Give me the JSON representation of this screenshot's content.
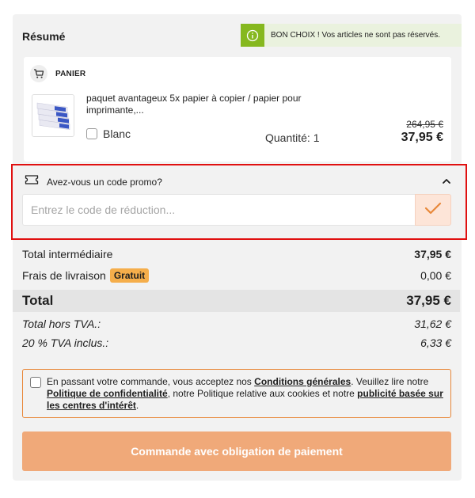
{
  "summary": {
    "title": "Résumé",
    "notice": "BON CHOIX ! Vos articles ne sont pas réservés."
  },
  "cart": {
    "label": "PANIER",
    "item": {
      "name": "paquet avantageux 5x papier à copier / papier pour imprimante,...",
      "variant": "Blanc",
      "quantity": "Quantité: 1",
      "old_price": "264,95 €",
      "price": "37,95 €"
    }
  },
  "promo": {
    "label": "Avez-vous un code promo?",
    "placeholder": "Entrez le code de réduction..."
  },
  "totals": {
    "subtotal_label": "Total intermédiaire",
    "subtotal_value": "37,95 €",
    "shipping_label": "Frais de livraison",
    "shipping_badge": "Gratuit",
    "shipping_value": "0,00 €",
    "total_label": "Total",
    "total_value": "37,95 €",
    "net_label": "Total hors TVA.:",
    "net_value": "31,62 €",
    "vat_label": "20 % TVA inclus.:",
    "vat_value": "6,33 €"
  },
  "terms": {
    "part1": "En passant votre commande, vous acceptez nos ",
    "link1": "Conditions générales",
    "part2": ". Veuillez lire notre ",
    "link2": "Politique de confidentialité",
    "part3": ", notre Politique relative aux cookies et notre ",
    "link3": "publicité basée sur les centres d'intérêt",
    "part4": "."
  },
  "cta": {
    "label": "Commande avec obligation de paiement"
  },
  "icons": {
    "notice": "info-icon",
    "cart": "cart-icon",
    "promo": "ticket-icon",
    "collapse": "chevron-up-icon",
    "apply": "check-icon"
  },
  "colors": {
    "notice_green": "#86b81f",
    "accent_orange": "#f0a979",
    "badge": "#f5ae4b",
    "highlight_red": "#e01010"
  }
}
